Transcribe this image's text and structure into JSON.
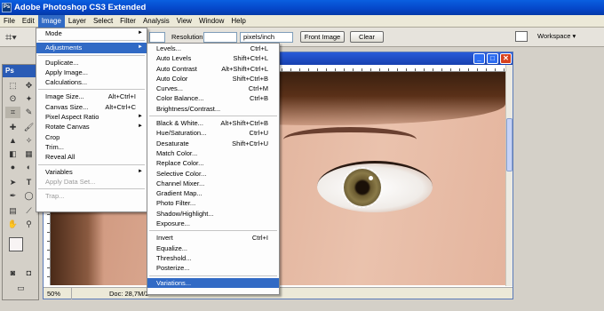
{
  "window": {
    "title": "Adobe Photoshop CS3 Extended",
    "ps_badge": "Ps"
  },
  "menubar": [
    "File",
    "Edit",
    "Image",
    "Layer",
    "Select",
    "Filter",
    "Analysis",
    "View",
    "Window",
    "Help"
  ],
  "options": {
    "resolution_label": "Resolution:",
    "resolution_value": "",
    "unit_value": "pixels/inch",
    "front_image": "Front Image",
    "clear": "Clear",
    "workspace": "Workspace ▾"
  },
  "tools": {
    "badge": "Ps"
  },
  "image_menu": {
    "items": [
      {
        "label": "Mode",
        "shortcut": "",
        "arrow": "►"
      },
      {
        "label": "Adjustments",
        "shortcut": "",
        "arrow": "►",
        "highlight": true
      },
      {
        "label": "Duplicate...",
        "shortcut": ""
      },
      {
        "label": "Apply Image...",
        "shortcut": ""
      },
      {
        "label": "Calculations...",
        "shortcut": ""
      },
      {
        "label": "Image Size...",
        "shortcut": "Alt+Ctrl+I"
      },
      {
        "label": "Canvas Size...",
        "shortcut": "Alt+Ctrl+C"
      },
      {
        "label": "Pixel Aspect Ratio",
        "shortcut": "",
        "arrow": "►"
      },
      {
        "label": "Rotate Canvas",
        "shortcut": "",
        "arrow": "►"
      },
      {
        "label": "Crop",
        "shortcut": ""
      },
      {
        "label": "Trim...",
        "shortcut": ""
      },
      {
        "label": "Reveal All",
        "shortcut": ""
      },
      {
        "label": "Variables",
        "shortcut": "",
        "arrow": "►"
      },
      {
        "label": "Apply Data Set...",
        "shortcut": "",
        "disabled": true
      },
      {
        "label": "Trap...",
        "shortcut": "",
        "disabled": true
      }
    ]
  },
  "adjust_menu": {
    "items": [
      {
        "label": "Levels...",
        "shortcut": "Ctrl+L"
      },
      {
        "label": "Auto Levels",
        "shortcut": "Shift+Ctrl+L"
      },
      {
        "label": "Auto Contrast",
        "shortcut": "Alt+Shift+Ctrl+L"
      },
      {
        "label": "Auto Color",
        "shortcut": "Shift+Ctrl+B"
      },
      {
        "label": "Curves...",
        "shortcut": "Ctrl+M"
      },
      {
        "label": "Color Balance...",
        "shortcut": "Ctrl+B"
      },
      {
        "label": "Brightness/Contrast...",
        "shortcut": ""
      },
      {
        "label": "Black & White...",
        "shortcut": "Alt+Shift+Ctrl+B"
      },
      {
        "label": "Hue/Saturation...",
        "shortcut": "Ctrl+U"
      },
      {
        "label": "Desaturate",
        "shortcut": "Shift+Ctrl+U"
      },
      {
        "label": "Match Color...",
        "shortcut": ""
      },
      {
        "label": "Replace Color...",
        "shortcut": ""
      },
      {
        "label": "Selective Color...",
        "shortcut": ""
      },
      {
        "label": "Channel Mixer...",
        "shortcut": ""
      },
      {
        "label": "Gradient Map...",
        "shortcut": ""
      },
      {
        "label": "Photo Filter...",
        "shortcut": ""
      },
      {
        "label": "Shadow/Highlight...",
        "shortcut": ""
      },
      {
        "label": "Exposure...",
        "shortcut": ""
      },
      {
        "label": "Invert",
        "shortcut": "Ctrl+I"
      },
      {
        "label": "Equalize...",
        "shortcut": ""
      },
      {
        "label": "Threshold...",
        "shortcut": ""
      },
      {
        "label": "Posterize...",
        "shortcut": ""
      },
      {
        "label": "Variations...",
        "shortcut": "",
        "highlight": true
      }
    ]
  },
  "document": {
    "zoom": "50%",
    "doc_info": "Doc: 28,7M/2"
  }
}
